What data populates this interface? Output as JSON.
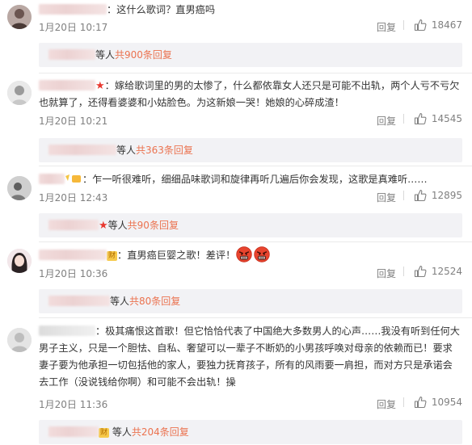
{
  "comments": [
    {
      "text": "：这什么歌词？直男癌吗",
      "time": "1月20日 10:17",
      "reply_label": "回复",
      "likes": "18467",
      "replies_prefix": "等人",
      "replies_count": "共900条回复"
    },
    {
      "text": "：嫁给歌词里的男的太惨了，什么都依靠女人还只是可能不出轨，两个人亏不亏欠也就算了，还得看婆婆和小姑脸色。为这新娘一哭！她娘的心碎成渣！",
      "time": "1月20日 10:21",
      "reply_label": "回复",
      "likes": "14545",
      "replies_prefix": "等人",
      "replies_count": "共363条回复"
    },
    {
      "text": "：乍一听很难听，细细品味歌词和旋律再听几遍后你会发现，这歌是真难听……",
      "time": "1月20日 12:43",
      "reply_label": "回复",
      "likes": "12895",
      "replies_prefix": "等人",
      "replies_count": "共90条回复"
    },
    {
      "badge": "财",
      "text": "：直男癌巨婴之歌！差评！",
      "time": "1月20日 10:36",
      "reply_label": "回复",
      "likes": "12524",
      "replies_prefix": "等人",
      "replies_count": "共80条回复"
    },
    {
      "text": "：极其痛恨这首歌！但它恰恰代表了中国绝大多数男人的心声……我没有听到任何大男子主义，只是一个胆怯、自私、奢望可以一辈子不断奶的小男孩呼唤对母亲的依赖而已！要求妻子要为他承担一切包括他的家人，要独力抚育孩子，所有的风雨要一肩担，而对方只是承诺会去工作（没说钱给你啊）和可能不会出轨！操",
      "time": "1月20日 11:36",
      "reply_label": "回复",
      "likes": "10954",
      "replies_badge": "财",
      "replies_prefix": "等人",
      "replies_count": "共204条回复"
    }
  ],
  "colors": {
    "link": "#eb7350",
    "meta": "#808080",
    "reply_bg": "#f2f2f5",
    "star": "#e8382f"
  },
  "icons": {
    "like": "thumbs-up-icon",
    "angry": "angry-face-emoji"
  }
}
